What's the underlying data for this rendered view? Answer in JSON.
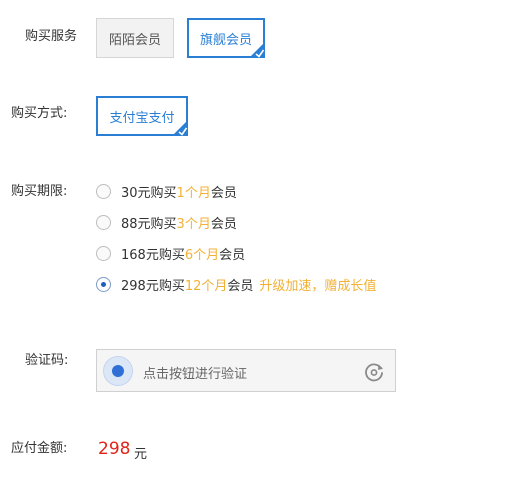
{
  "purchase_service": {
    "label": "购买服务",
    "options": [
      {
        "label": "陌陌会员",
        "selected": false
      },
      {
        "label": "旗舰会员",
        "selected": true
      }
    ]
  },
  "purchase_method": {
    "label": "购买方式:",
    "options": [
      {
        "label": "支付宝支付",
        "selected": true
      }
    ]
  },
  "purchase_period": {
    "label": "购买期限:",
    "options": [
      {
        "prefix": "30元购买",
        "duration": "1个月",
        "suffix": "会员",
        "extra": "",
        "selected": false
      },
      {
        "prefix": "88元购买",
        "duration": "3个月",
        "suffix": "会员",
        "extra": "",
        "selected": false
      },
      {
        "prefix": "168元购买",
        "duration": "6个月",
        "suffix": "会员",
        "extra": "",
        "selected": false
      },
      {
        "prefix": "298元购买",
        "duration": "12个月",
        "suffix": "会员",
        "extra": "升级加速，赠成长值",
        "selected": true
      }
    ]
  },
  "captcha": {
    "label": "验证码:",
    "prompt": "点击按钮进行验证",
    "icon": "refresh-icon"
  },
  "payment": {
    "label": "应付金额:",
    "amount": "298",
    "unit": "元"
  },
  "colors": {
    "accent": "#2a7fd4",
    "highlight": "#f2b134",
    "price": "#e2231a"
  }
}
